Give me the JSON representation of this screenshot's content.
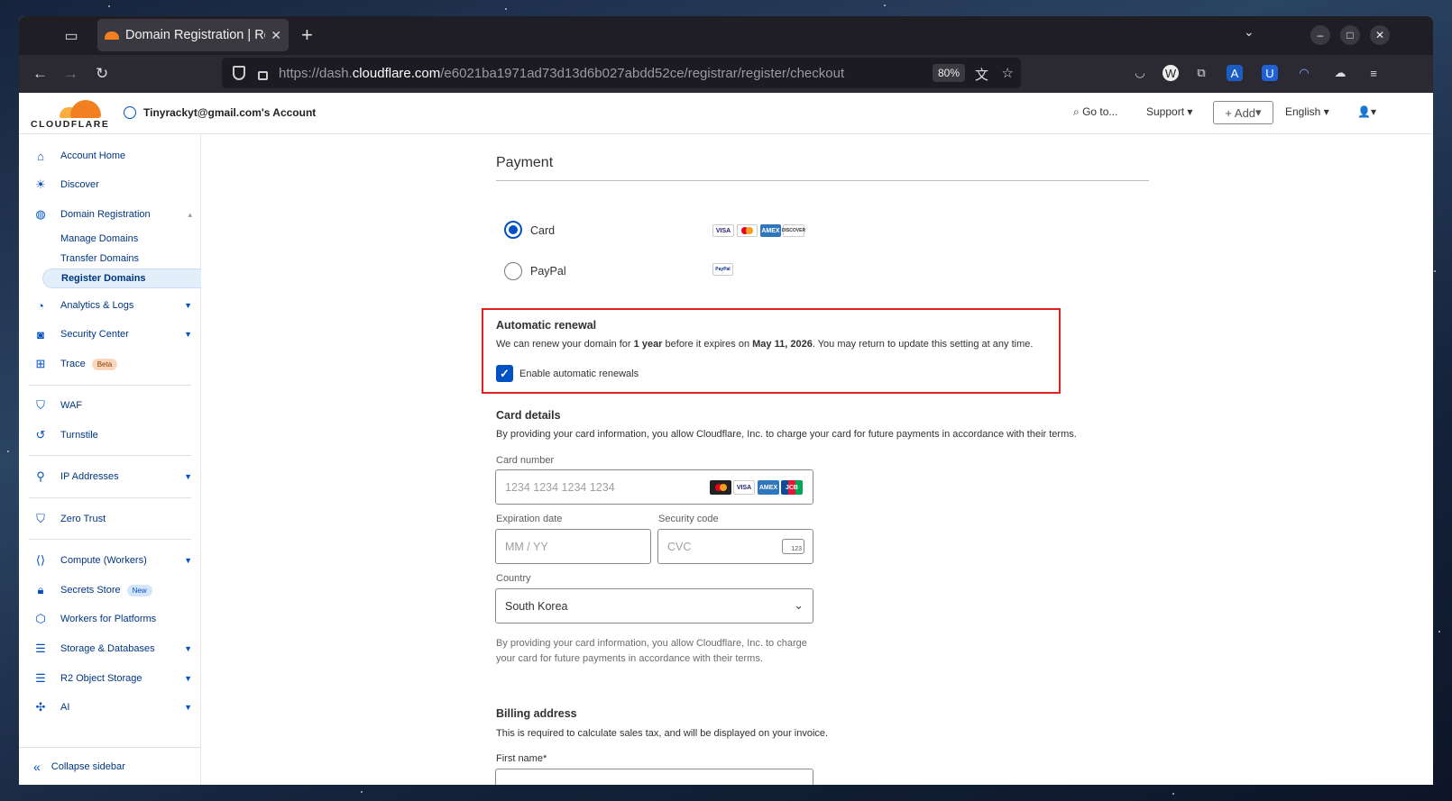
{
  "browser": {
    "tab_title": "Domain Registration | Re",
    "url_prefix": "https://dash.",
    "url_domain": "cloudflare.com",
    "url_path": "/e6021ba1971ad73d13d6b027abdd52ce/registrar/register/checkout",
    "zoom": "80%"
  },
  "header": {
    "logo_text": "CLOUDFLARE",
    "account": "Tinyrackyt@gmail.com's Account",
    "goto": "Go to...",
    "support": "Support",
    "add": "+ Add",
    "language": "English"
  },
  "sidebar": {
    "account_home": "Account Home",
    "discover": "Discover",
    "domain_registration": "Domain Registration",
    "manage_domains": "Manage Domains",
    "transfer_domains": "Transfer Domains",
    "register_domains": "Register Domains",
    "analytics": "Analytics & Logs",
    "security_center": "Security Center",
    "trace": "Trace",
    "trace_badge": "Beta",
    "waf": "WAF",
    "turnstile": "Turnstile",
    "ip_addresses": "IP Addresses",
    "zero_trust": "Zero Trust",
    "compute": "Compute (Workers)",
    "secrets_store": "Secrets Store",
    "secrets_badge": "New",
    "workers_platforms": "Workers for Platforms",
    "storage_db": "Storage & Databases",
    "r2": "R2 Object Storage",
    "ai": "AI",
    "collapse": "Collapse sidebar"
  },
  "payment": {
    "title": "Payment",
    "card_label": "Card",
    "paypal_label": "PayPal",
    "selected": "Card"
  },
  "renewal": {
    "title": "Automatic renewal",
    "text_a": "We can renew your domain for ",
    "text_b": "1 year",
    "text_c": " before it expires on ",
    "text_d": "May 11, 2026",
    "text_e": ". You may return to update this setting at any time.",
    "checkbox_label": "Enable automatic renewals",
    "checked": true
  },
  "card_details": {
    "title": "Card details",
    "text": "By providing your card information, you allow Cloudflare, Inc. to charge your card for future payments in accordance with their terms.",
    "card_number_label": "Card number",
    "card_number_placeholder": "1234 1234 1234 1234",
    "expiry_label": "Expiration date",
    "expiry_placeholder": "MM / YY",
    "cvc_label": "Security code",
    "cvc_placeholder": "CVC",
    "cvc_icon_text": "123",
    "country_label": "Country",
    "country_value": "South Korea",
    "disclaimer": "By providing your card information, you allow Cloudflare, Inc. to charge your card for future payments in accordance with their terms."
  },
  "billing": {
    "title": "Billing address",
    "text": "This is required to calculate sales tax, and will be displayed on your invoice.",
    "first_name_label": "First name*"
  },
  "card_brands": {
    "visa": "VISA",
    "amex": "AMEX",
    "discover": "DISCOVER",
    "jcb": "JCB",
    "paypal": "PayPal"
  },
  "colors": {
    "accent": "#0051c3",
    "highlight_box": "#e0201e",
    "brand_orange": "#f38020"
  }
}
